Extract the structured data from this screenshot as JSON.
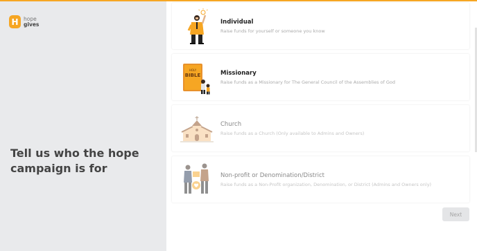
{
  "brand": {
    "logo_line1": "hope",
    "logo_line2": "gives",
    "accent": "#f6a623"
  },
  "left_panel": {
    "heading": "Tell us who the hope campaign is for"
  },
  "options": [
    {
      "title": "Individual",
      "description": "Raise funds for yourself or someone you know",
      "icon": "person-lightbulb-icon",
      "enabled": true
    },
    {
      "title": "Missionary",
      "description": "Raise funds as a Missionary for The General Council of the Assemblies of God",
      "icon": "bible-icon",
      "bible_label_top": "HOLY",
      "bible_label": "BIBLE",
      "enabled": true
    },
    {
      "title": "Church",
      "description": "Raise funds as a Church (Only available to Admins and Owners)",
      "icon": "church-icon",
      "enabled": false
    },
    {
      "title": "Non-profit or Denomination/District",
      "description": "Raise funds as a Non-Profit organization, Denomination, or District (Admins and Owners only)",
      "icon": "people-giving-icon",
      "enabled": false
    }
  ],
  "footer": {
    "next_label": "Next"
  }
}
